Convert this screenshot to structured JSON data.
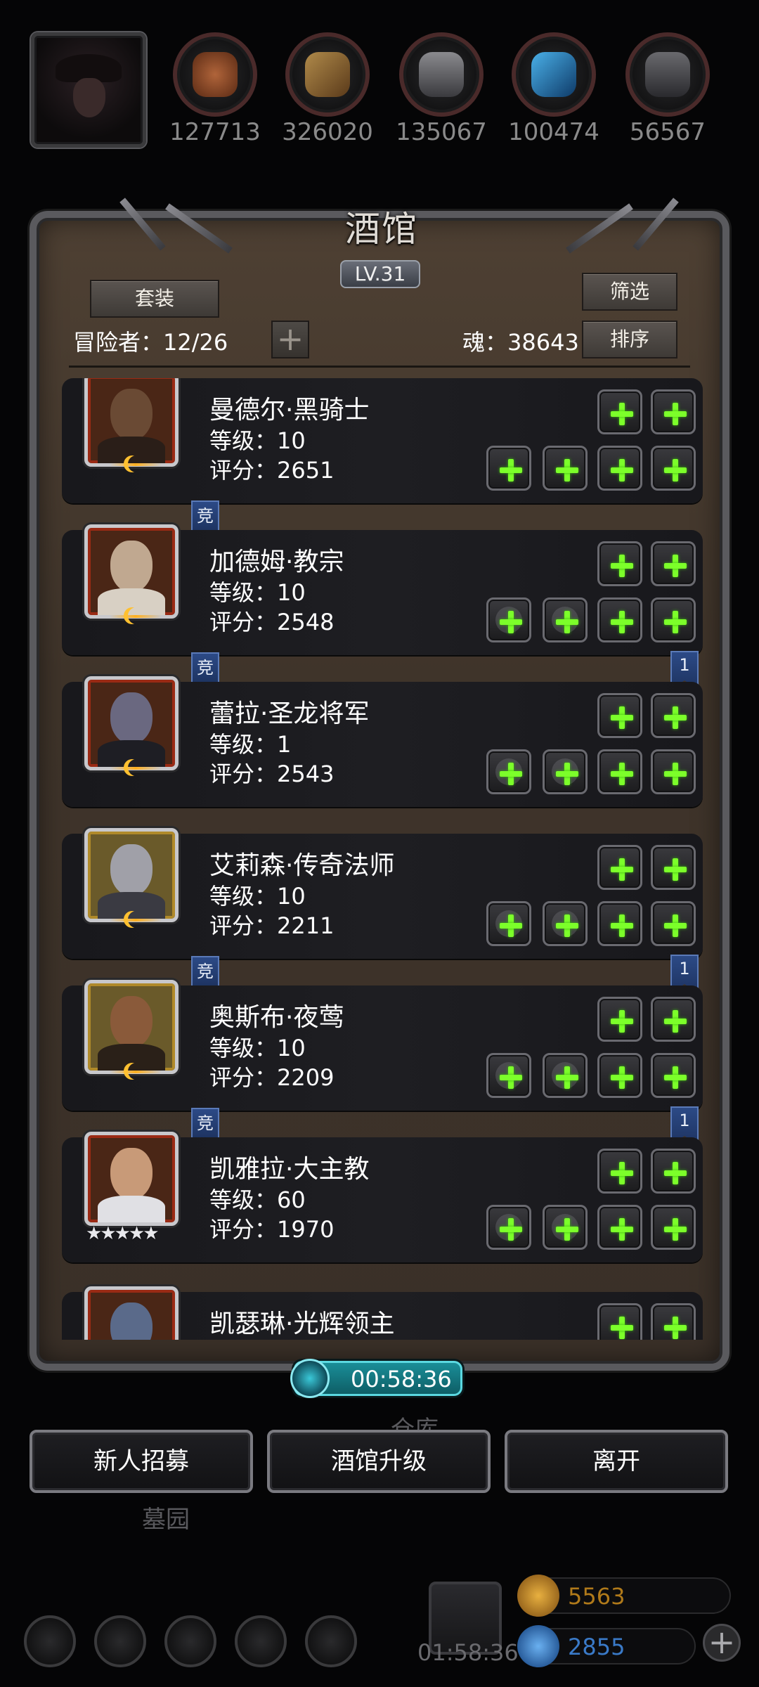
{
  "resources": [
    {
      "name": "meat-icon",
      "value": "127713",
      "color": "#8a4a2a"
    },
    {
      "name": "wood-icon",
      "value": "326020",
      "color": "#8a6a3a"
    },
    {
      "name": "iron-icon",
      "value": "135067",
      "color": "#6a6a6e"
    },
    {
      "name": "crystal-icon",
      "value": "100474",
      "color": "#2a8ac8"
    },
    {
      "name": "steel-icon",
      "value": "56567",
      "color": "#5a5a5e"
    }
  ],
  "panel": {
    "title": "酒馆",
    "level": "LV.31",
    "set_button": "套装",
    "filter_button": "筛选",
    "sort_button": "排序",
    "adventurers_label": "冒险者：12/26",
    "soul_label": "魂：38643"
  },
  "heroes": [
    {
      "name": "曼德尔·黑骑士",
      "level": "等级：10",
      "score": "评分：2651",
      "frame": "red",
      "rank": "moon",
      "jing": "竞",
      "num": ""
    },
    {
      "name": "加德姆·教宗",
      "level": "等级：10",
      "score": "评分：2548",
      "frame": "red",
      "rank": "moon",
      "jing": "竞",
      "num": "1"
    },
    {
      "name": "蕾拉·圣龙将军",
      "level": "等级：1",
      "score": "评分：2543",
      "frame": "red",
      "rank": "moon",
      "jing": "",
      "num": ""
    },
    {
      "name": "艾莉森·传奇法师",
      "level": "等级：10",
      "score": "评分：2211",
      "frame": "gold",
      "rank": "moon",
      "jing": "竞",
      "num": "1"
    },
    {
      "name": "奥斯布·夜莺",
      "level": "等级：10",
      "score": "评分：2209",
      "frame": "gold",
      "rank": "moon",
      "jing": "竞",
      "num": "1"
    },
    {
      "name": "凯雅拉·大主教",
      "level": "等级：60",
      "score": "评分：1970",
      "frame": "red",
      "rank": "stars",
      "jing": "",
      "num": ""
    },
    {
      "name": "凯瑟琳·光辉领主",
      "level": "",
      "score": "",
      "frame": "red",
      "rank": "",
      "jing": "",
      "num": ""
    }
  ],
  "stars_text": "★★★★★",
  "timer": "00:58:36",
  "actions": {
    "recruit": "新人招募",
    "upgrade": "酒馆升级",
    "leave": "离开"
  },
  "background": {
    "warehouse_label": "仓库",
    "cemetery_label": "墓园",
    "gift_timer": "01:58:36",
    "gold": "5563",
    "gems": "2855"
  },
  "colors": {
    "accent_green": "#7cff2a",
    "timer_teal": "#1a8e98",
    "tag_blue": "#2c4a86",
    "gold_text": "#b07a1a",
    "gem_text": "#3a7ac8"
  }
}
